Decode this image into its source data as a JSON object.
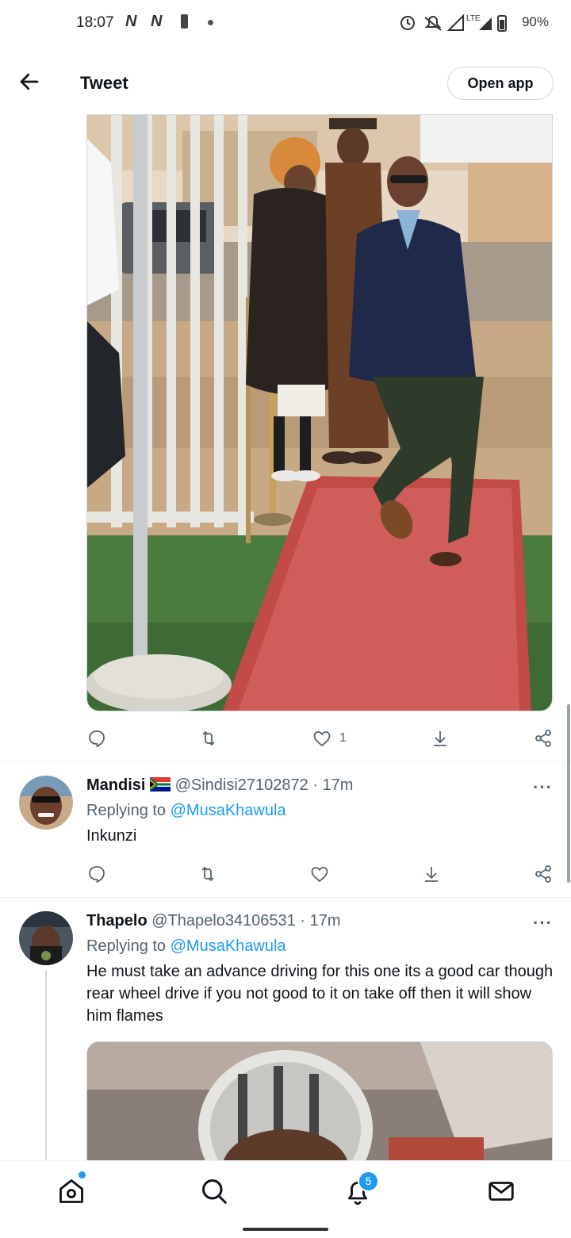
{
  "status_bar": {
    "time": "18:07",
    "left_icons": [
      "N",
      "N"
    ],
    "network": "LTE",
    "battery": "90%"
  },
  "header": {
    "back_icon": "arrow-left-icon",
    "title": "Tweet",
    "open_app_label": "Open app"
  },
  "main_tweet": {
    "media_alt": "photo",
    "actions": {
      "reply_icon": "reply-icon",
      "retweet_icon": "retweet-icon",
      "like_icon": "heart-icon",
      "like_count": "1",
      "share_icon": "share-icon",
      "more_share_icon": "share-network-icon"
    }
  },
  "replies": [
    {
      "name": "Mandisi",
      "flag": "south-africa-flag-icon",
      "handle": "@Sindisi27102872 · 17m",
      "replying_prefix": "Replying to ",
      "replying_to": "@MusaKhawula",
      "text": "Inkunzi",
      "more": "···"
    },
    {
      "name": "Thapelo",
      "handle": "@Thapelo34106531 · 17m",
      "replying_prefix": "Replying to ",
      "replying_to": "@MusaKhawula",
      "text": "He must take an advance driving for this one its a good car though rear wheel drive if you not good to it on take off then it will show him flames",
      "more": "···"
    }
  ],
  "bottom_nav": {
    "home_icon": "home-icon",
    "search_icon": "search-icon",
    "notifications_icon": "bell-icon",
    "notifications_badge": "5",
    "messages_icon": "mail-icon"
  },
  "colors": {
    "accent": "#1d9bf0",
    "text": "#0f1419",
    "secondary": "#536471"
  }
}
